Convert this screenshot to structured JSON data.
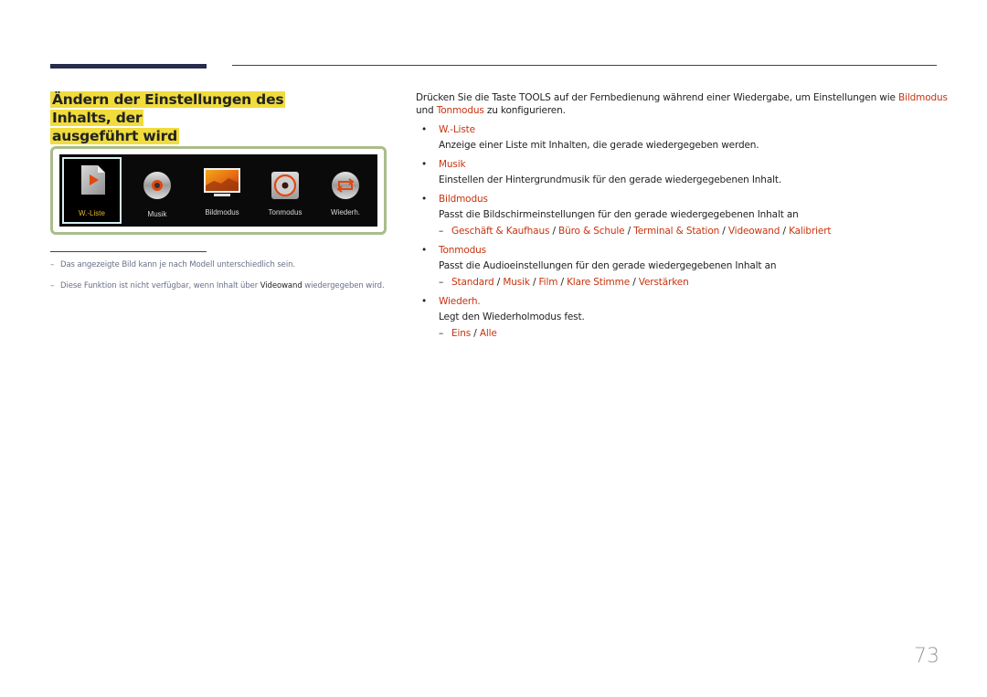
{
  "section": {
    "title_line1": "Ändern der Einstellungen des Inhalts, der",
    "title_line2": "ausgeführt wird"
  },
  "osd_menu": {
    "items": [
      {
        "label": "W.-Liste",
        "icon": "playlist-file-icon",
        "selected": true
      },
      {
        "label": "Musik",
        "icon": "music-disc-icon",
        "selected": false
      },
      {
        "label": "Bildmodus",
        "icon": "picture-mode-icon",
        "selected": false
      },
      {
        "label": "Tonmodus",
        "icon": "sound-mode-icon",
        "selected": false
      },
      {
        "label": "Wiederh.",
        "icon": "repeat-icon",
        "selected": false
      }
    ],
    "selected_label_color": "#e2b72a"
  },
  "notes": [
    {
      "dash": "–",
      "text": "Das angezeigte Bild kann je nach Modell unterschiedlich sein."
    },
    {
      "dash": "–",
      "text_before": "Diese Funktion ist nicht verfügbar, wenn Inhalt über ",
      "emphasis": "Videowand",
      "text_after": " wiedergegeben wird."
    }
  ],
  "intro": {
    "part1": "Drücken Sie die Taste ",
    "key": "TOOLS",
    "part2": " auf der Fernbedienung während einer Wiedergabe, um Einstellungen wie ",
    "link1": "Bildmodus",
    "part3": "und ",
    "link2": "Tonmodus",
    "part4": " zu konfigurieren."
  },
  "bullets": [
    {
      "term": "W.-Liste",
      "desc": "Anzeige einer Liste mit Inhalten, die gerade wiedergegeben werden.",
      "options": []
    },
    {
      "term": "Musik",
      "desc": "Einstellen der Hintergrundmusik für den gerade wiedergegebenen Inhalt.",
      "options": []
    },
    {
      "term": "Bildmodus",
      "desc": "Passt die Bildschirmeinstellungen für den gerade wiedergegebenen Inhalt an",
      "options": [
        "Geschäft & Kaufhaus",
        "Büro & Schule",
        "Terminal & Station",
        "Videowand",
        "Kalibriert"
      ]
    },
    {
      "term": "Tonmodus",
      "desc": "Passt die Audioeinstellungen für den gerade wiedergegebenen Inhalt an",
      "options": [
        "Standard",
        "Musik",
        "Film",
        "Klare Stimme",
        "Verstärken"
      ]
    },
    {
      "term": "Wiederh.",
      "desc": "Legt den Wiederholmodus fest.",
      "options": [
        "Eins",
        "Alle"
      ]
    }
  ],
  "symbols": {
    "bullet": "•",
    "dash": "–",
    "separator": " / "
  },
  "colors": {
    "accent_red": "#c8330e",
    "highlight_yellow": "#f0dc3c",
    "rule_navy": "#252c4c",
    "frame_green": "#a9bd8b"
  },
  "page_number": "73"
}
